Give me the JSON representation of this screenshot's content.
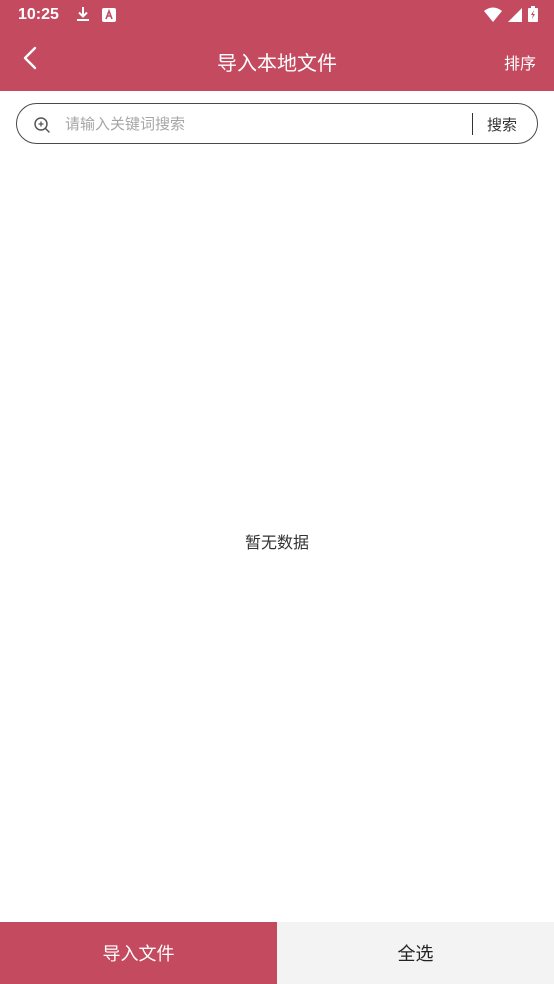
{
  "status_bar": {
    "time": "10:25",
    "icons_left": [
      "download-icon",
      "a-notification-icon"
    ],
    "icons_right": [
      "wifi-icon",
      "signal-icon",
      "battery-icon"
    ]
  },
  "header": {
    "title": "导入本地文件",
    "sort_label": "排序",
    "back_icon": "chevron-left-icon",
    "background_color": "#c44a60"
  },
  "search": {
    "placeholder": "请输入关键词搜索",
    "value": "",
    "button_label": "搜索"
  },
  "main": {
    "empty_message": "暂无数据"
  },
  "bottom_bar": {
    "import_label": "导入文件",
    "select_all_label": "全选"
  }
}
